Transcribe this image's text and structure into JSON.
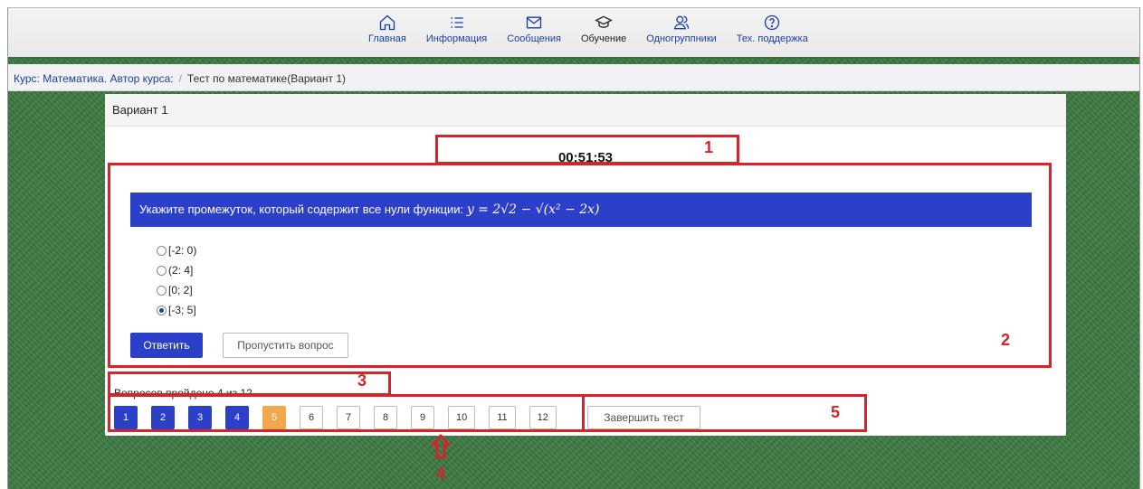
{
  "nav": {
    "items": [
      {
        "label": "Главная",
        "icon": "home-icon"
      },
      {
        "label": "Информация",
        "icon": "list-icon"
      },
      {
        "label": "Сообщения",
        "icon": "envelope-icon"
      },
      {
        "label": "Обучение",
        "icon": "graduation-cap-icon"
      },
      {
        "label": "Одногруппники",
        "icon": "people-icon"
      },
      {
        "label": "Тех. поддержка",
        "icon": "help-icon"
      }
    ],
    "active": "Обучение"
  },
  "breadcrumb": {
    "course": "Курс: Математика. Автор курса:",
    "separator": "/",
    "current": "Тест по математике(Вариант 1)"
  },
  "card": {
    "title": "Вариант 1",
    "timer": "00:51:53"
  },
  "question": {
    "text": "Укажите промежуток, который содержит все нули функции:",
    "formula": "y = 2√2 − √(x² − 2x)",
    "options": [
      "[-2: 0)",
      "(2: 4]",
      "[0; 2]",
      "[-3; 5]"
    ],
    "selected_index": 3
  },
  "buttons": {
    "answer": "Ответить",
    "skip": "Пропустить вопрос",
    "finish": "Завершить тест"
  },
  "progress": {
    "text": "Вопросов пройдено 4 из 12",
    "pages": [
      "1",
      "2",
      "3",
      "4",
      "5",
      "6",
      "7",
      "8",
      "9",
      "10",
      "11",
      "12"
    ],
    "completed": 4,
    "current": 5
  },
  "annotations": [
    "1",
    "2",
    "3",
    "4",
    "5"
  ],
  "colors": {
    "primary_blue": "#2b3fc9",
    "current_orange": "#f0a84a",
    "annotation_red": "#d6242a",
    "background_green": "#3d7a43"
  }
}
